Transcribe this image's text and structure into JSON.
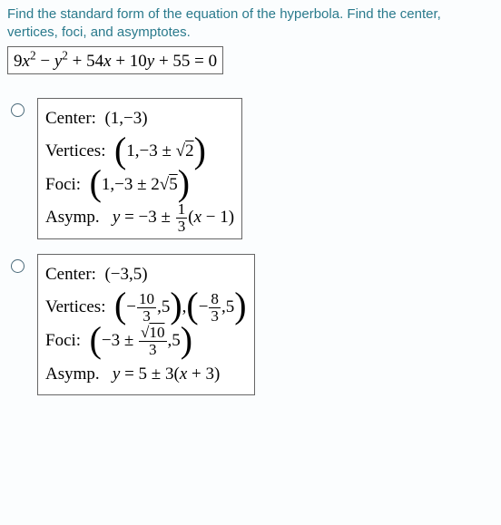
{
  "prompt": {
    "line1": "Find the standard form of the equation of the hyperbola. Find the center,",
    "line2": "vertices, foci, and asymptotes."
  },
  "equation": {
    "text_html": "9<i>x</i><span class='sup'>2</span> − <i>y</i><span class='sup'>2</span> + 54<i>x</i> + 10<i>y</i> + 55 = 0"
  },
  "options": [
    {
      "center_label": "Center:",
      "center_value": "(1,−3)",
      "vertices_label": "Vertices:",
      "vertices_html": "<span class='bigparen'>(</span>1,−3 ± √<span class='rad'>2</span><span class='bigparen'>)</span>",
      "foci_label": "Foci:",
      "foci_html": "<span class='bigparen'>(</span>1,−3 ± 2√<span class='rad'>5</span><span class='bigparen'>)</span>",
      "asymp_label": "Asymp.",
      "asymp_html": "<i>y</i> = −3 ± <span class='frac'><span class='num'>1</span><span class='den'>3</span></span>(<i>x</i> − 1)"
    },
    {
      "center_label": "Center:",
      "center_value": "(−3,5)",
      "vertices_label": "Vertices:",
      "vertices_html": "<span class='bigparen'>(</span>−<span class='frac'><span class='num'>10</span><span class='den'>3</span></span>,5<span class='bigparen'>)</span>,<span class='bigparen'>(</span>−<span class='frac'><span class='num'>8</span><span class='den'>3</span></span>,5<span class='bigparen'>)</span>",
      "foci_label": "Foci:",
      "foci_html": "<span class='bigparen'>(</span>−3 ± <span class='frac'><span class='num'>√<span class=\"rad\">10</span></span><span class='den'>3</span></span>,5<span class='bigparen'>)</span>",
      "asymp_label": "Asymp.",
      "asymp_html": "<i>y</i> = 5 ± 3(<i>x</i> + 3)"
    }
  ]
}
